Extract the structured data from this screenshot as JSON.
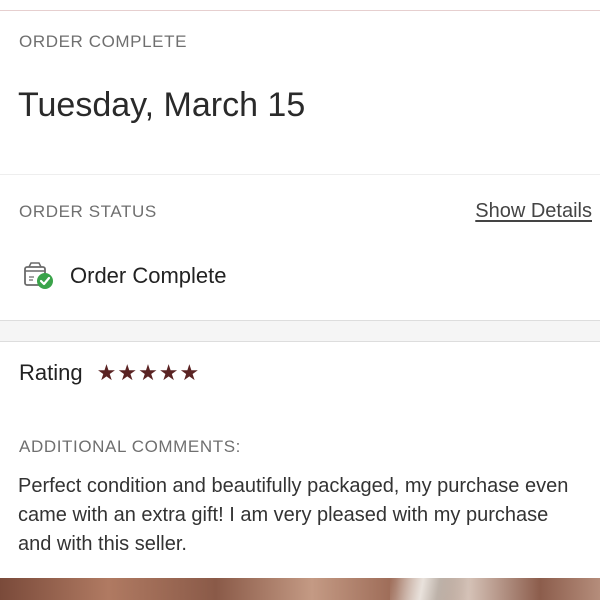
{
  "header": {
    "section_label": "ORDER COMPLETE",
    "date": "Tuesday, March 15"
  },
  "order_status": {
    "section_label": "ORDER STATUS",
    "link_label": "Show Details",
    "status_text": "Order Complete",
    "status_icon": "box-check-icon",
    "check_color": "#3aa34a"
  },
  "rating": {
    "label": "Rating",
    "stars": 5,
    "star_color": "#5a2323"
  },
  "comments": {
    "section_label": "ADDITIONAL COMMENTS:",
    "text": "Perfect condition and beautifully packaged, my purchase even came with an extra gift! I am very pleased with my purchase and with this seller."
  }
}
